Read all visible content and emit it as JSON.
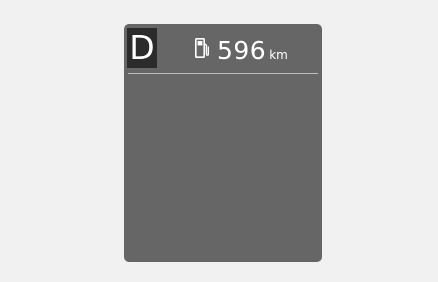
{
  "display": {
    "gear": "D",
    "fuel_icon": "fuel-pump-icon",
    "range_value": "596",
    "range_unit": "km"
  },
  "colors": {
    "page_background": "#f1f1f1",
    "display_background": "#666666",
    "gear_box": "#2b2b2b",
    "text": "#ffffff",
    "divider": "#bdbdbd"
  }
}
